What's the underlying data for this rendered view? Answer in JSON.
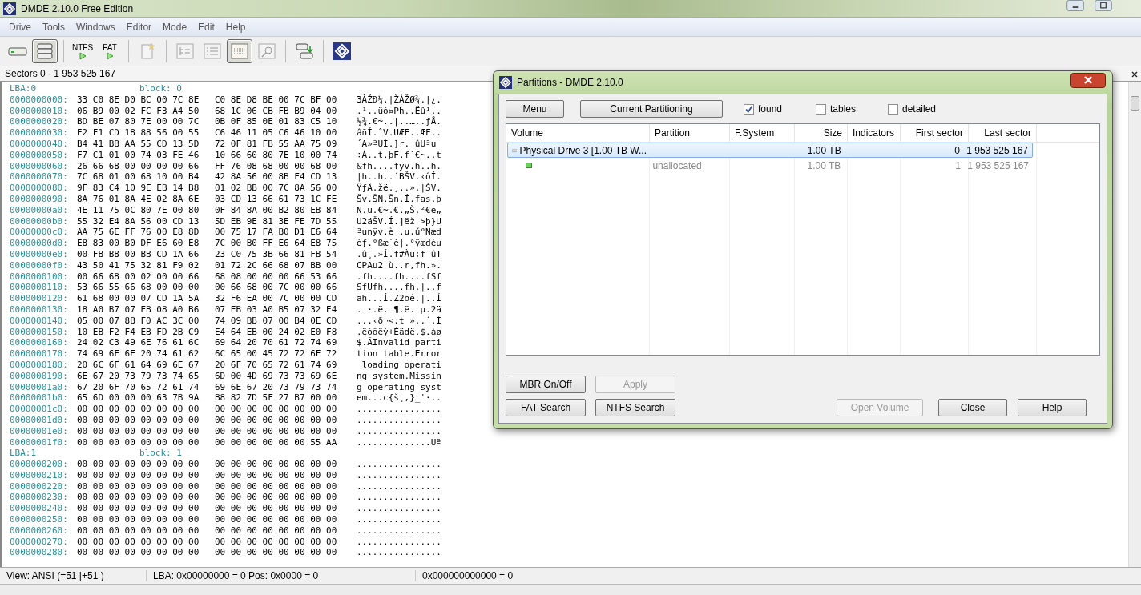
{
  "window": {
    "title": "DMDE 2.10.0 Free Edition"
  },
  "menu": [
    "Drive",
    "Tools",
    "Windows",
    "Editor",
    "Mode",
    "Edit",
    "Help"
  ],
  "toolbar": [
    {
      "kind": "drive",
      "pressed": false
    },
    {
      "kind": "stack",
      "pressed": true
    },
    {
      "kind": "run",
      "label": "NTFS",
      "pressed": false
    },
    {
      "kind": "run",
      "label": "FAT",
      "pressed": false
    },
    {
      "kind": "page",
      "pressed": false
    },
    {
      "kind": "tree",
      "pressed": false
    },
    {
      "kind": "list",
      "pressed": false
    },
    {
      "kind": "hex",
      "pressed": true
    },
    {
      "kind": "find",
      "pressed": false
    },
    {
      "kind": "export",
      "pressed": false
    },
    {
      "kind": "logo",
      "pressed": false
    }
  ],
  "sectors_label": "Sectors 0 - 1 953 525 167",
  "hex_lines": [
    {
      "kind": "header",
      "lba": "LBA:0",
      "block": "block: 0"
    },
    {
      "kind": "row",
      "offset": "0000000000:",
      "a": "33 C0 8E D0 BC 00 7C 8E",
      "b": "C0 8E D8 BE 00 7C BF 00",
      "ascii": "3ÀŽÐ¼.|ŽÀŽØ¾.|¿."
    },
    {
      "kind": "row",
      "offset": "0000000010:",
      "a": "06 B9 00 02 FC F3 A4 50",
      "b": "68 1C 06 CB FB B9 04 00",
      "ascii": ".¹..üó¤Ph..Ëû¹.."
    },
    {
      "kind": "row",
      "offset": "0000000020:",
      "a": "BD BE 07 80 7E 00 00 7C",
      "b": "0B 0F 85 0E 01 83 C5 10",
      "ascii": "½¾.€~..|..…..ƒÅ."
    },
    {
      "kind": "row",
      "offset": "0000000030:",
      "a": "E2 F1 CD 18 88 56 00 55",
      "b": "C6 46 11 05 C6 46 10 00",
      "ascii": "âñÍ.ˆV.UÆF..ÆF.."
    },
    {
      "kind": "row",
      "offset": "0000000040:",
      "a": "B4 41 BB AA 55 CD 13 5D",
      "b": "72 0F 81 FB 55 AA 75 09",
      "ascii": "´A»ªUÍ.]r. ûUªu"
    },
    {
      "kind": "row",
      "offset": "0000000050:",
      "a": "F7 C1 01 00 74 03 FE 46",
      "b": "10 66 60 80 7E 10 00 74",
      "ascii": "÷Á..t.þF.f`€~..t"
    },
    {
      "kind": "row",
      "offset": "0000000060:",
      "a": "26 66 68 00 00 00 00 66",
      "b": "FF 76 08 68 00 00 68 00",
      "ascii": "&fh....fÿv.h..h."
    },
    {
      "kind": "row",
      "offset": "0000000070:",
      "a": "7C 68 01 00 68 10 00 B4",
      "b": "42 8A 56 00 8B F4 CD 13",
      "ascii": "|h..h..´BŠV.‹ôÍ."
    },
    {
      "kind": "row",
      "offset": "0000000080:",
      "a": "9F 83 C4 10 9E EB 14 B8",
      "b": "01 02 BB 00 7C 8A 56 00",
      "ascii": "ŸƒÄ.žë.¸..».|ŠV."
    },
    {
      "kind": "row",
      "offset": "0000000090:",
      "a": "8A 76 01 8A 4E 02 8A 6E",
      "b": "03 CD 13 66 61 73 1C FE",
      "ascii": "Šv.ŠN.Šn.Í.fas.þ"
    },
    {
      "kind": "row",
      "offset": "00000000a0:",
      "a": "4E 11 75 0C 80 7E 00 80",
      "b": "0F 84 8A 00 B2 80 EB 84",
      "ascii": "N.u.€~.€.„Š.²€ë„"
    },
    {
      "kind": "row",
      "offset": "00000000b0:",
      "a": "55 32 E4 8A 56 00 CD 13",
      "b": "5D EB 9E 81 3E FE 7D 55",
      "ascii": "U2äŠV.Í.]ëž >þ}U"
    },
    {
      "kind": "row",
      "offset": "00000000c0:",
      "a": "AA 75 6E FF 76 00 E8 8D",
      "b": "00 75 17 FA B0 D1 E6 64",
      "ascii": "ªunÿv.è .u.ú°Ñæd"
    },
    {
      "kind": "row",
      "offset": "00000000d0:",
      "a": "E8 83 00 B0 DF E6 60 E8",
      "b": "7C 00 B0 FF E6 64 E8 75",
      "ascii": "èƒ.°ßæ`è|.°ÿædèu"
    },
    {
      "kind": "row",
      "offset": "00000000e0:",
      "a": "00 FB B8 00 BB CD 1A 66",
      "b": "23 C0 75 3B 66 81 FB 54",
      "ascii": ".û¸.»Í.f#Àu;f ûT"
    },
    {
      "kind": "row",
      "offset": "00000000f0:",
      "a": "43 50 41 75 32 81 F9 02",
      "b": "01 72 2C 66 68 07 BB 00",
      "ascii": "CPAu2 ù..r,fh.»."
    },
    {
      "kind": "row",
      "offset": "0000000100:",
      "a": "00 66 68 00 02 00 00 66",
      "b": "68 08 00 00 00 66 53 66",
      "ascii": ".fh....fh....fSf"
    },
    {
      "kind": "row",
      "offset": "0000000110:",
      "a": "53 66 55 66 68 00 00 00",
      "b": "00 66 68 00 7C 00 00 66",
      "ascii": "SfUfh....fh.|..f"
    },
    {
      "kind": "row",
      "offset": "0000000120:",
      "a": "61 68 00 00 07 CD 1A 5A",
      "b": "32 F6 EA 00 7C 00 00 CD",
      "ascii": "ah...Í.Z2öê.|..Í"
    },
    {
      "kind": "row",
      "offset": "0000000130:",
      "a": "18 A0 B7 07 EB 08 A0 B6",
      "b": "07 EB 03 A0 B5 07 32 E4",
      "ascii": ". ·.ë. ¶.ë. µ.2ä"
    },
    {
      "kind": "row",
      "offset": "0000000140:",
      "a": "05 00 07 8B F0 AC 3C 00",
      "b": "74 09 BB 07 00 B4 0E CD",
      "ascii": "...‹ð¬<.t »..´.Í"
    },
    {
      "kind": "row",
      "offset": "0000000150:",
      "a": "10 EB F2 F4 EB FD 2B C9",
      "b": "E4 64 EB 00 24 02 E0 F8",
      "ascii": ".ëòôëý+Éädë.$.àø"
    },
    {
      "kind": "row",
      "offset": "0000000160:",
      "a": "24 02 C3 49 6E 76 61 6C",
      "b": "69 64 20 70 61 72 74 69",
      "ascii": "$.ÃInvalid parti"
    },
    {
      "kind": "row",
      "offset": "0000000170:",
      "a": "74 69 6F 6E 20 74 61 62",
      "b": "6C 65 00 45 72 72 6F 72",
      "ascii": "tion table.Error"
    },
    {
      "kind": "row",
      "offset": "0000000180:",
      "a": "20 6C 6F 61 64 69 6E 67",
      "b": "20 6F 70 65 72 61 74 69",
      "ascii": " loading operati"
    },
    {
      "kind": "row",
      "offset": "0000000190:",
      "a": "6E 67 20 73 79 73 74 65",
      "b": "6D 00 4D 69 73 73 69 6E",
      "ascii": "ng system.Missin"
    },
    {
      "kind": "row",
      "offset": "00000001a0:",
      "a": "67 20 6F 70 65 72 61 74",
      "b": "69 6E 67 20 73 79 73 74",
      "ascii": "g operating syst"
    },
    {
      "kind": "row",
      "offset": "00000001b0:",
      "a": "65 6D 00 00 00 63 7B 9A",
      "b": "B8 82 7D 5F 27 B7 00 00",
      "ascii": "em...c{š¸‚}_'·.."
    },
    {
      "kind": "row",
      "offset": "00000001c0:",
      "a": "00 00 00 00 00 00 00 00",
      "b": "00 00 00 00 00 00 00 00",
      "ascii": "................"
    },
    {
      "kind": "row",
      "offset": "00000001d0:",
      "a": "00 00 00 00 00 00 00 00",
      "b": "00 00 00 00 00 00 00 00",
      "ascii": "................"
    },
    {
      "kind": "row",
      "offset": "00000001e0:",
      "a": "00 00 00 00 00 00 00 00",
      "b": "00 00 00 00 00 00 00 00",
      "ascii": "................"
    },
    {
      "kind": "row",
      "offset": "00000001f0:",
      "a": "00 00 00 00 00 00 00 00",
      "b": "00 00 00 00 00 00 55 AA",
      "ascii": "..............Uª"
    },
    {
      "kind": "header",
      "lba": "LBA:1",
      "block": "block: 1"
    },
    {
      "kind": "row",
      "offset": "0000000200:",
      "a": "00 00 00 00 00 00 00 00",
      "b": "00 00 00 00 00 00 00 00",
      "ascii": "................"
    },
    {
      "kind": "row",
      "offset": "0000000210:",
      "a": "00 00 00 00 00 00 00 00",
      "b": "00 00 00 00 00 00 00 00",
      "ascii": "................"
    },
    {
      "kind": "row",
      "offset": "0000000220:",
      "a": "00 00 00 00 00 00 00 00",
      "b": "00 00 00 00 00 00 00 00",
      "ascii": "................"
    },
    {
      "kind": "row",
      "offset": "0000000230:",
      "a": "00 00 00 00 00 00 00 00",
      "b": "00 00 00 00 00 00 00 00",
      "ascii": "................"
    },
    {
      "kind": "row",
      "offset": "0000000240:",
      "a": "00 00 00 00 00 00 00 00",
      "b": "00 00 00 00 00 00 00 00",
      "ascii": "................"
    },
    {
      "kind": "row",
      "offset": "0000000250:",
      "a": "00 00 00 00 00 00 00 00",
      "b": "00 00 00 00 00 00 00 00",
      "ascii": "................"
    },
    {
      "kind": "row",
      "offset": "0000000260:",
      "a": "00 00 00 00 00 00 00 00",
      "b": "00 00 00 00 00 00 00 00",
      "ascii": "................"
    },
    {
      "kind": "row",
      "offset": "0000000270:",
      "a": "00 00 00 00 00 00 00 00",
      "b": "00 00 00 00 00 00 00 00",
      "ascii": "................"
    },
    {
      "kind": "row",
      "offset": "0000000280:",
      "a": "00 00 00 00 00 00 00 00",
      "b": "00 00 00 00 00 00 00 00",
      "ascii": "................"
    }
  ],
  "status_bar": [
    "View: ANSI (=51 |+51 )",
    "LBA: 0x00000000 = 0  Pos: 0x0000 = 0",
    "0x000000000000 = 0"
  ],
  "dialog": {
    "title": "Partitions - DMDE 2.10.0",
    "top_buttons": [
      "Menu",
      "Current Partitioning"
    ],
    "checkboxes": [
      {
        "label": "found",
        "checked": true
      },
      {
        "label": "tables",
        "checked": false
      },
      {
        "label": "detailed",
        "checked": false
      }
    ],
    "columns": [
      "Volume",
      "Partition",
      "F.System",
      "Size",
      "Indicators",
      "First sector",
      "Last sector"
    ],
    "rows": [
      {
        "volume": "Physical Drive 3 [1.00 TB W...",
        "size": "1.00 TB",
        "first": "0",
        "last": "1 953 525 167",
        "selected": true,
        "children": [
          {
            "partition": "unallocated",
            "size": "1.00 TB",
            "first": "1",
            "last": "1 953 525 167",
            "selected": false
          }
        ]
      }
    ],
    "buttons_row1": [
      {
        "label": "MBR On/Off",
        "disabled": false
      },
      {
        "label": "Apply",
        "disabled": true
      }
    ],
    "buttons_row2": [
      {
        "label": "FAT Search",
        "disabled": false
      },
      {
        "label": "NTFS Search",
        "disabled": false
      }
    ],
    "buttons_right": [
      {
        "label": "Open Volume",
        "disabled": true
      },
      {
        "label": "Close",
        "disabled": false
      },
      {
        "label": "Help",
        "disabled": false
      }
    ]
  }
}
